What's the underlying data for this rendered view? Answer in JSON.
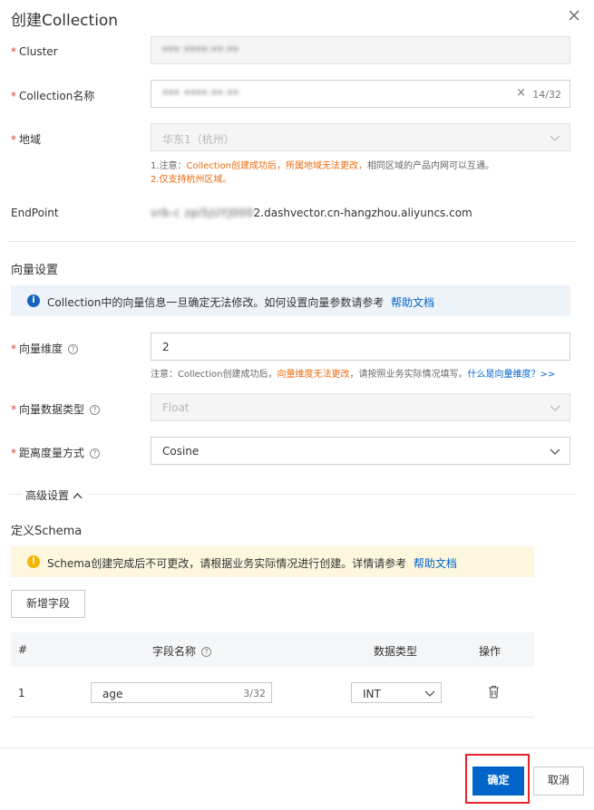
{
  "dialog": {
    "title": "创建Collection",
    "close_icon": "close-icon"
  },
  "form": {
    "cluster": {
      "label": "Cluster",
      "value": "*** ****·**·**"
    },
    "collection_name": {
      "label": "Collection名称",
      "value": "*** ****·**·**",
      "counter": "14/32",
      "clear": "×"
    },
    "region": {
      "label": "地域",
      "value": "华东1（杭州）",
      "note_prefix": "1.注意：",
      "note_warn": "Collection创建成功后，所属地域无法更改，",
      "note_suffix": "相同区域的产品内网可以互通。",
      "note_line2": "2.仅支持杭州区域。"
    },
    "endpoint": {
      "label": "EndPoint",
      "value_hidden": "vrb-c zpi5jUYJ000",
      "value_visible": "2.dashvector.cn-hangzhou.aliyuncs.com"
    }
  },
  "vector_settings": {
    "title": "向量设置",
    "banner_text": "Collection中的向量信息一旦确定无法修改。如何设置向量参数请参考",
    "banner_link": "帮助文档",
    "dimension": {
      "label": "向量维度",
      "value": "2",
      "note_prefix": "注意：Collection创建成功后，",
      "note_warn": "向量维度无法更改",
      "note_suffix": "，请按照业务实际情况填写。",
      "note_link": "什么是向量维度？>>"
    },
    "data_type": {
      "label": "向量数据类型",
      "value": "Float"
    },
    "metric": {
      "label": "距离度量方式",
      "value": "Cosine"
    }
  },
  "advanced": {
    "label": "高级设置",
    "chevron_icon": "chevron-up-icon"
  },
  "schema": {
    "title": "定义Schema",
    "banner_text": "Schema创建完成后不可更改，请根据业务实际情况进行创建。详情请参考",
    "banner_link": "帮助文档",
    "add_button": "新增字段",
    "columns": {
      "index": "#",
      "name": "字段名称",
      "type": "数据类型",
      "action": "操作"
    },
    "rows": [
      {
        "index": "1",
        "name": "age",
        "counter": "3/32",
        "type": "INT"
      }
    ]
  },
  "footer": {
    "confirm": "确定",
    "cancel": "取消"
  },
  "colors": {
    "primary": "#0064c8",
    "warning_text": "#ed6a0c",
    "required": "#e23c39",
    "highlight": "#e3242b"
  }
}
